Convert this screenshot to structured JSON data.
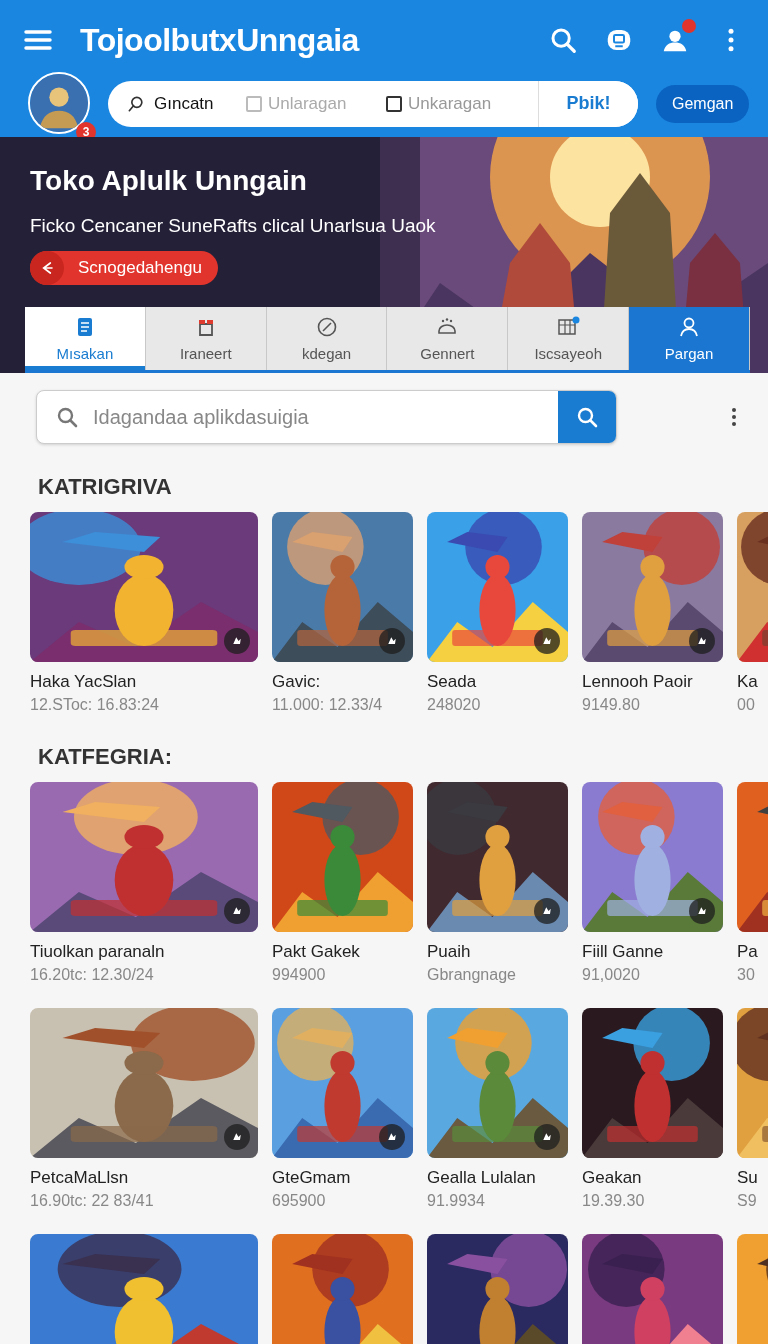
{
  "app_bar": {
    "title": "TojoolbutxUnngaia",
    "notification_badge": true
  },
  "profile": {
    "badge": "3"
  },
  "filter_bar": {
    "search_label": "Gıncatn",
    "checkboxes": [
      {
        "label": "Unlaragan",
        "checked": false,
        "disabled": true
      },
      {
        "label": "Unkaragan",
        "checked": false,
        "disabled": false
      }
    ],
    "action": "Pbik!"
  },
  "header_button": "Gemgan",
  "banner": {
    "title": "Toko Aplulk Unngain",
    "subtitle": "Ficko Cencaner SuneRafts clical Unarlsua Uaok",
    "button": "Scnogedahengu"
  },
  "tabs": [
    {
      "label": "Mısakan",
      "selected": true,
      "accent": false
    },
    {
      "label": "Iraneert",
      "selected": false,
      "accent": false
    },
    {
      "label": "kdegan",
      "selected": false,
      "accent": false
    },
    {
      "label": "Gennert",
      "selected": false,
      "accent": false
    },
    {
      "label": "Iscsayeoh",
      "selected": false,
      "accent": false
    },
    {
      "label": "Pargan",
      "selected": false,
      "accent": true
    }
  ],
  "search": {
    "placeholder": "Idagandaa aplikdasuigia"
  },
  "sections": [
    {
      "title": "KATRIGRIVA",
      "rows": [
        [
          {
            "name": "Haka YacSlan",
            "info": "12.SToc: 16.83:24",
            "overlay_icon": true
          },
          {
            "name": "Gavic:",
            "info": "11.000:  12.33/4",
            "overlay_icon": true
          },
          {
            "name": "Seada",
            "info": "248020",
            "overlay_icon": true
          },
          {
            "name": "Lennooh Paoir",
            "info": "9149.80",
            "overlay_icon": true
          },
          {
            "name": "Ka",
            "info": "00",
            "overlay_icon": false
          }
        ]
      ]
    },
    {
      "title": "KATFEGRIA:",
      "rows": [
        [
          {
            "name": "Tiuolkan paranaln",
            "info": "16.20tc: 12.30/24",
            "overlay_icon": true
          },
          {
            "name": "Pakt Gakek",
            "info": "994900",
            "overlay_icon": false
          },
          {
            "name": "Puaih",
            "info": "Gbrangnage",
            "overlay_icon": true
          },
          {
            "name": "Fiill Ganne",
            "info": "91,0020",
            "overlay_icon": true
          },
          {
            "name": "Pa",
            "info": "30",
            "overlay_icon": false
          }
        ],
        [
          {
            "name": "PetcaMaLlsn",
            "info": "16.90tc: 22 83/41",
            "overlay_icon": true
          },
          {
            "name": "GteGmam",
            "info": "695900",
            "overlay_icon": true
          },
          {
            "name": "Gealla Lulalan",
            "info": "91.9934",
            "overlay_icon": true
          },
          {
            "name": "Geakan",
            "info": "19.39.30",
            "overlay_icon": false
          },
          {
            "name": "Su",
            "info": "S9",
            "overlay_icon": false
          }
        ],
        [
          {
            "overlay_icon": false
          },
          {
            "overlay_icon": false
          },
          {
            "overlay_icon": false
          },
          {
            "overlay_icon": false
          },
          {
            "overlay_icon": false
          }
        ]
      ]
    }
  ]
}
